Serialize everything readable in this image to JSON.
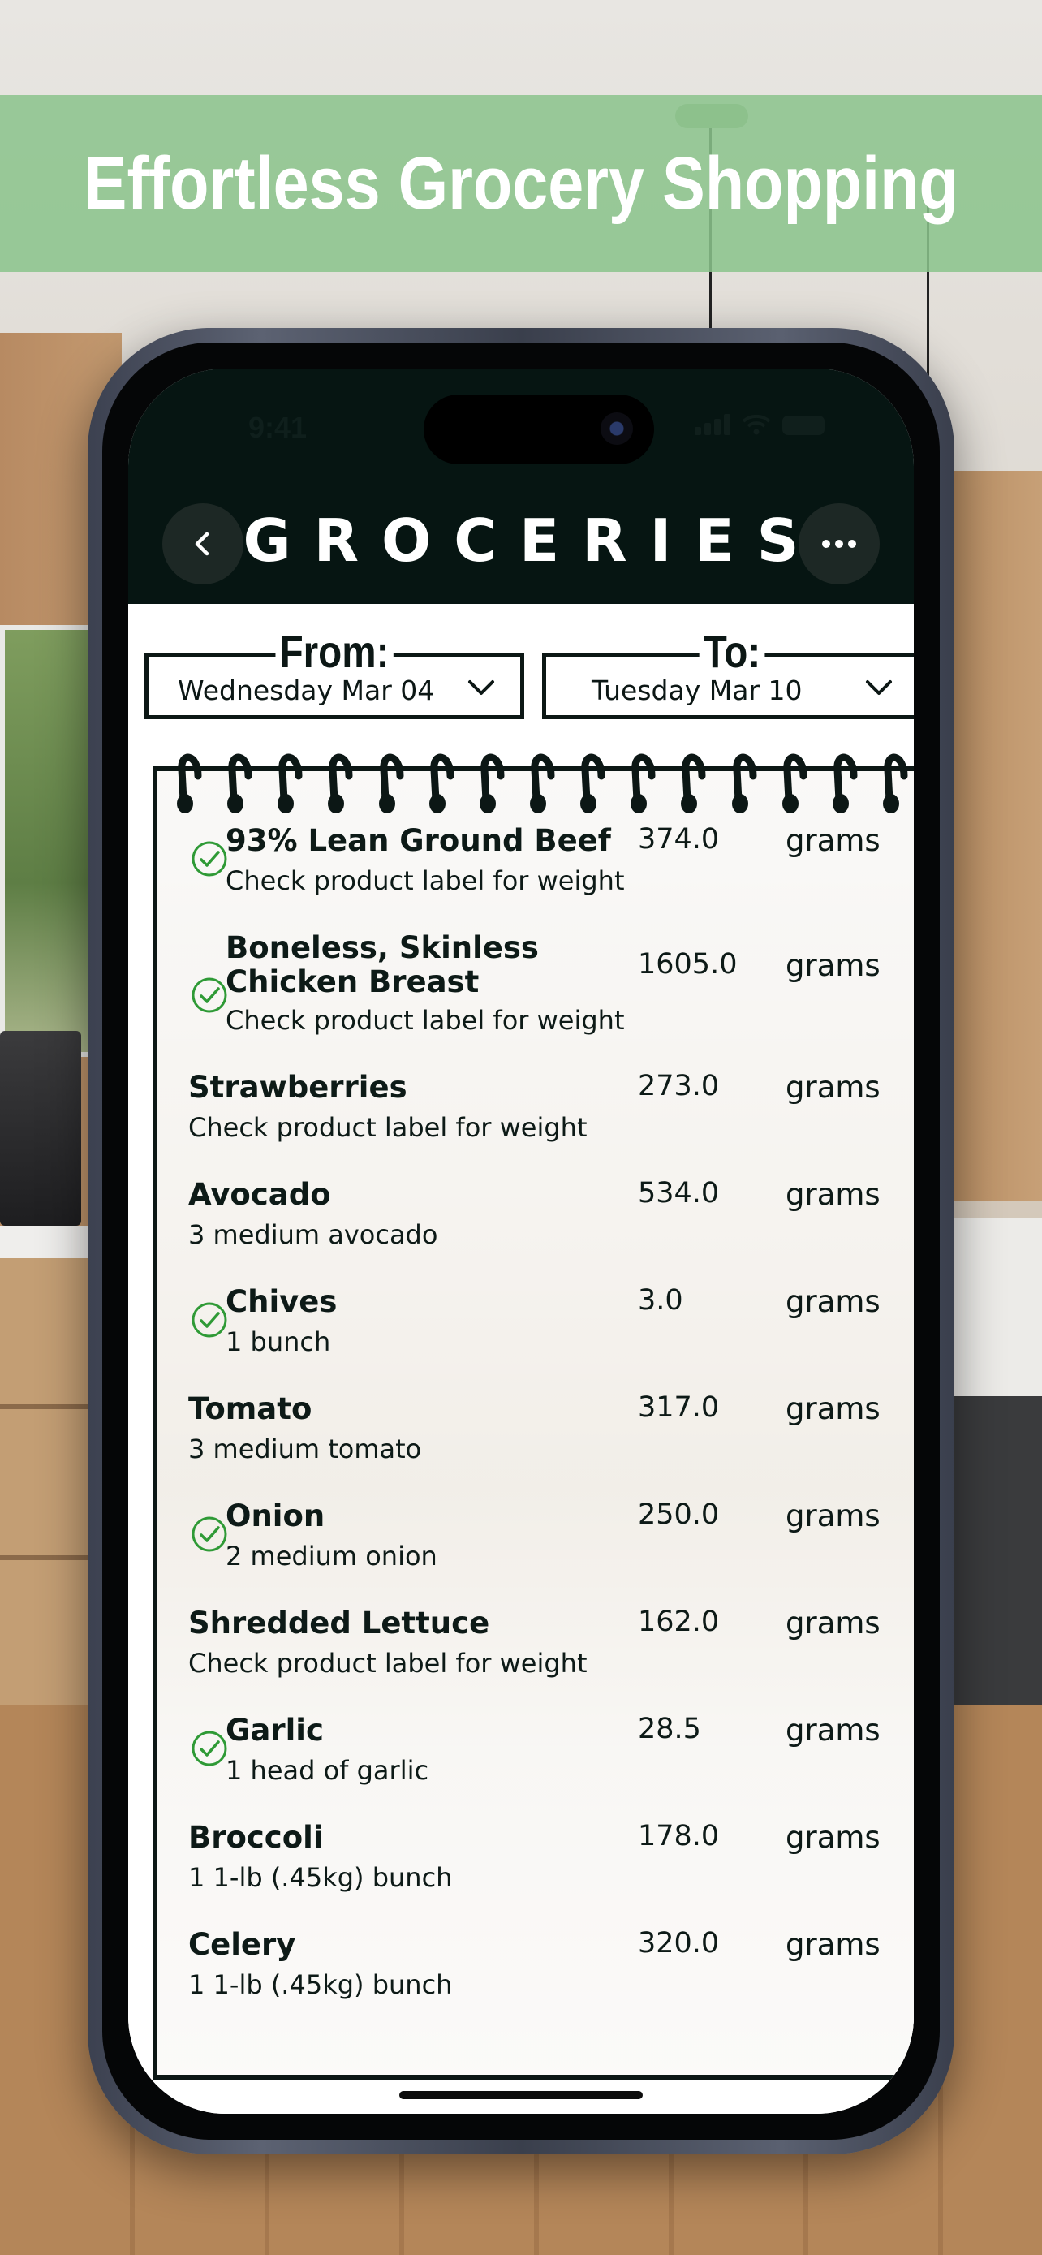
{
  "banner": {
    "title": "Effortless Grocery Shopping"
  },
  "status_bar": {
    "time": "9:41"
  },
  "header": {
    "title": "GROCERIES"
  },
  "date_range": {
    "from_label": "From:",
    "from_value": "Wednesday Mar 04",
    "to_label": "To:",
    "to_value": "Tuesday Mar 10"
  },
  "items": [
    {
      "name": "93% Lean Ground Beef",
      "note": "Check product label for weight",
      "qty": "374.0",
      "unit": "grams",
      "checked": true
    },
    {
      "name": "Boneless, Skinless",
      "name2": "Chicken Breast",
      "note": "Check product label for weight",
      "qty": "1605.0",
      "unit": "grams",
      "checked": true
    },
    {
      "name": "Strawberries",
      "note": "Check product label for weight",
      "qty": "273.0",
      "unit": "grams",
      "checked": false
    },
    {
      "name": "Avocado",
      "note": "3  medium avocado",
      "qty": "534.0",
      "unit": "grams",
      "checked": false
    },
    {
      "name": "Chives",
      "note": "1  bunch",
      "qty": "3.0",
      "unit": "grams",
      "checked": true
    },
    {
      "name": "Tomato",
      "note": "3  medium tomato",
      "qty": "317.0",
      "unit": "grams",
      "checked": false
    },
    {
      "name": "Onion",
      "note": "2  medium onion",
      "qty": "250.0",
      "unit": "grams",
      "checked": true
    },
    {
      "name": "Shredded Lettuce",
      "note": "Check product label for weight",
      "qty": "162.0",
      "unit": "grams",
      "checked": false
    },
    {
      "name": "Garlic",
      "note": "1  head of garlic",
      "qty": "28.5",
      "unit": "grams",
      "checked": true
    },
    {
      "name": "Broccoli",
      "note": "1  1-lb (.45kg) bunch",
      "qty": "178.0",
      "unit": "grams",
      "checked": false
    },
    {
      "name": "Celery",
      "note": "1  1-lb (.45kg) bunch",
      "qty": "320.0",
      "unit": "grams",
      "checked": false
    }
  ],
  "icons": {
    "back": "chevron-left-icon",
    "more": "ellipsis-icon",
    "check": "check-circle-icon",
    "dropdown": "chevron-down-icon"
  },
  "colors": {
    "banner": "#8ac48c",
    "header": "#061512",
    "check": "#2f9a36",
    "ink": "#0c1715"
  }
}
